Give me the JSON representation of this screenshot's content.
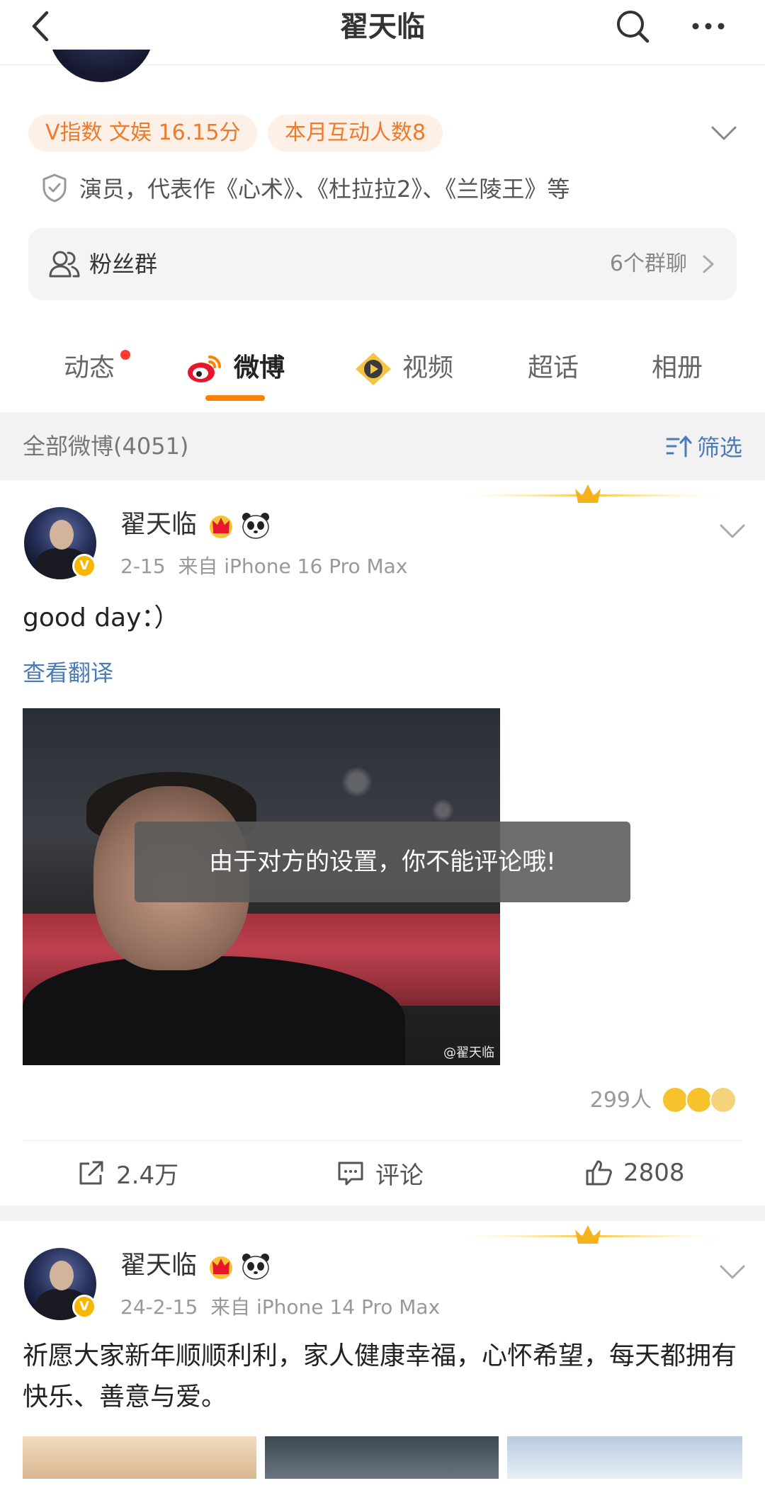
{
  "nav": {
    "title": "翟天临"
  },
  "profile": {
    "pills": [
      "V指数 文娱 16.15分",
      "本月互动人数8"
    ],
    "verified_text": "演员，代表作《心术》、《杜拉拉2》、《兰陵王》等",
    "fans_group": {
      "label": "粉丝群",
      "count": "6个群聊"
    }
  },
  "tabs": [
    {
      "label": "动态",
      "has_dot": true
    },
    {
      "label": "微博",
      "active": true
    },
    {
      "label": "视频"
    },
    {
      "label": "超话"
    },
    {
      "label": "相册"
    }
  ],
  "filter": {
    "label": "全部微博(4051)",
    "button": "筛选"
  },
  "posts": [
    {
      "author": "翟天临",
      "date": "2-15",
      "source": "来自 iPhone 16 Pro Max",
      "text": "good day：）",
      "translate_link": "查看翻译",
      "image_watermark": "@翟天临",
      "reaction_count": "299人",
      "actions": {
        "share": "2.4万",
        "comment": "评论",
        "like": "2808"
      }
    },
    {
      "author": "翟天临",
      "date": "24-2-15",
      "source": "来自 iPhone 14 Pro Max",
      "text": "祈愿大家新年顺顺利利，家人健康幸福，心怀希望，每天都拥有快乐、善意与爱。"
    }
  ],
  "toast": {
    "message": "由于对方的设置，你不能评论哦!"
  },
  "colors": {
    "accent": "#ff8200",
    "link": "#4a7ab8",
    "pill_text": "#ee7a2c",
    "pill_bg": "#fdf0e6",
    "badge_gold": "#f6b700"
  },
  "icons": [
    "back-icon",
    "search-icon",
    "more-icon",
    "chevron-down-icon",
    "shield-icon",
    "fans-group-icon",
    "chevron-right-icon",
    "weibo-icon",
    "video-icon",
    "filter-icon",
    "crown-icon",
    "panda-icon",
    "share-icon",
    "comment-icon",
    "like-icon"
  ]
}
